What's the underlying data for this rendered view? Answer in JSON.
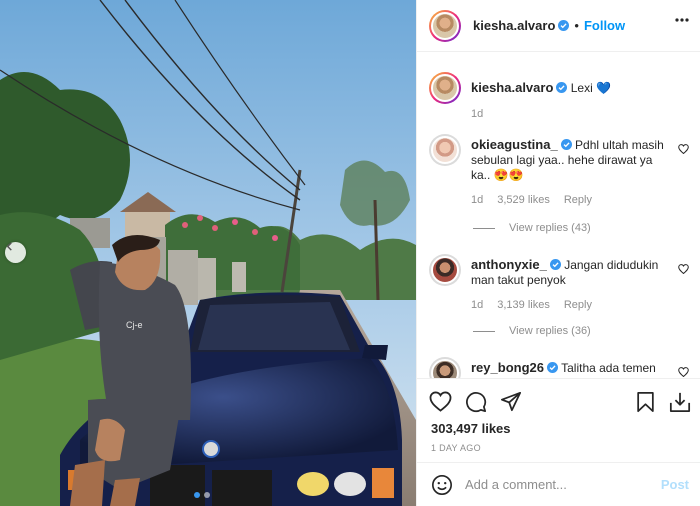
{
  "post": {
    "author": "kiesha.alvaro",
    "separator": "•",
    "follow_label": "Follow",
    "caption": {
      "username": "kiesha.alvaro",
      "text": "Lexi",
      "emoji": "💙",
      "time": "1d"
    },
    "comments": [
      {
        "username": "okieagustina_",
        "text": "Pdhl ultah masih sebulan lagi yaa.. hehe dirawat ya ka.. 😍😍",
        "time": "1d",
        "likes": "3,529 likes",
        "reply_label": "Reply",
        "view_replies": "View replies (43)"
      },
      {
        "username": "anthonyxie_",
        "text": "Jangan didudukin man takut penyok",
        "time": "1d",
        "likes": "3,139 likes",
        "reply_label": "Reply",
        "view_replies": "View replies (36)"
      },
      {
        "username": "rey_bong26",
        "text": "Talitha ada temen"
      }
    ],
    "likes_count": "303,497 likes",
    "posted_ago": "1 DAY AGO"
  },
  "add_comment": {
    "placeholder": "Add a comment...",
    "post_label": "Post"
  },
  "photo": {
    "shirt_text": "Cj-e"
  },
  "carousel": {
    "slide_count": 2,
    "active_index": 0
  },
  "icons": {
    "verified": "verified-badge-icon",
    "more": "more-options-icon",
    "heart": "heart-icon",
    "comment": "comment-icon",
    "share": "paper-plane-icon",
    "save": "bookmark-icon",
    "download": "download-icon",
    "emoji": "smiley-icon",
    "prev": "chevron-left-icon"
  },
  "colors": {
    "accent": "#0095f6",
    "verified": "#3897f0",
    "muted": "#8e8e8e",
    "post_disabled": "#b2dffc",
    "active_dot": "#3897f0"
  }
}
